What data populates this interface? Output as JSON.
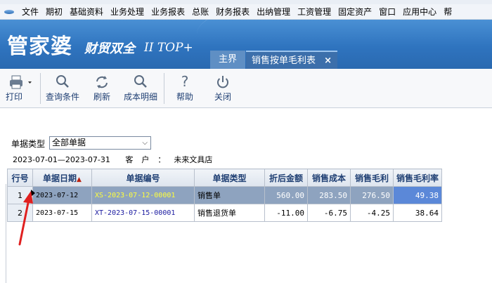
{
  "menubar": {
    "items": [
      "文件",
      "期初",
      "基础资料",
      "业务处理",
      "业务报表",
      "总账",
      "财务报表",
      "出纳管理",
      "工资管理",
      "固定资产",
      "窗口",
      "应用中心",
      "帮"
    ]
  },
  "banner": {
    "brand": "管家婆",
    "brand_sub": "财贸双全",
    "brand_ver": "II TOP+"
  },
  "tabs": {
    "home": "主界面",
    "active": "销售按单毛利表",
    "close": "×"
  },
  "toolbar": {
    "print": "打印",
    "query": "查询条件",
    "refresh": "刷新",
    "cost_detail": "成本明细",
    "help": "帮助",
    "close": "关闭"
  },
  "filter": {
    "label": "单据类型",
    "value": "全部单据",
    "date_range": "2023-07-01—2023-07-31",
    "customer_label": "客户：",
    "customer": "未来文具店"
  },
  "grid": {
    "columns": [
      "行号",
      "单据日期",
      "单据编号",
      "单据类型",
      "折后金额",
      "销售成本",
      "销售毛利",
      "销售毛利率"
    ],
    "rows": [
      {
        "no": "1",
        "date": "2023-07-12",
        "code": "XS-2023-07-12-00001",
        "type": "销售单",
        "amount": "560.00",
        "cost": "283.50",
        "profit": "276.50",
        "rate": "49.38"
      },
      {
        "no": "2",
        "date": "2023-07-15",
        "code": "XT-2023-07-15-00001",
        "type": "销售退货单",
        "amount": "-11.00",
        "cost": "-6.75",
        "profit": "-4.25",
        "rate": "38.64"
      }
    ]
  },
  "colors": {
    "banner": "#2f74bf",
    "selected_row": "#8ea3bf",
    "highlight_cell": "#5b88d8",
    "annotation": "#e02020"
  }
}
